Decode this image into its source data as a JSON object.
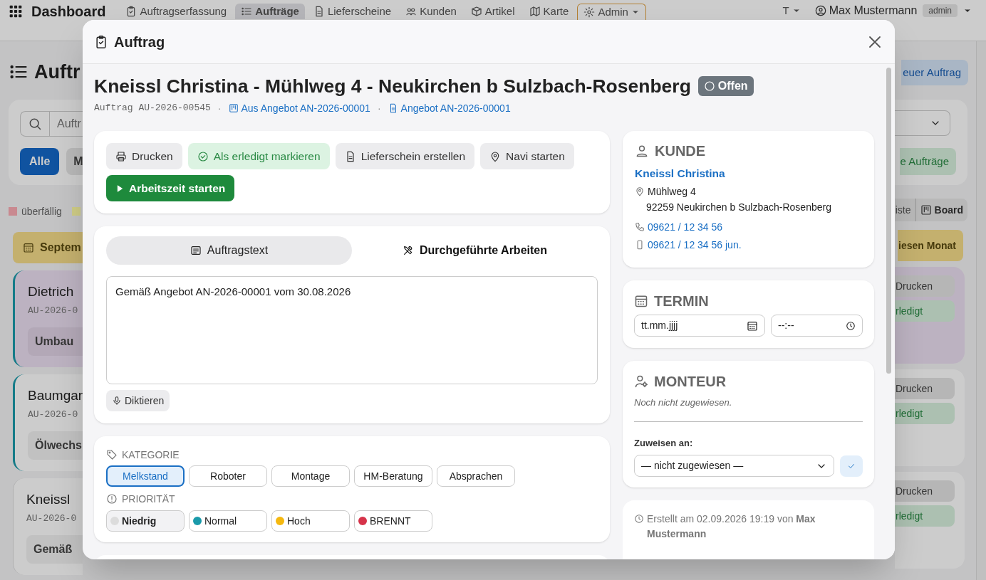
{
  "navbar": {
    "brand": "Dashboard",
    "items": [
      {
        "label": "Auftragserfassung",
        "selected": false,
        "kind": "link"
      },
      {
        "label": "Aufträge",
        "selected": true,
        "kind": "link"
      },
      {
        "label": "Lieferscheine",
        "selected": false,
        "kind": "link"
      },
      {
        "label": "Kunden",
        "selected": false,
        "kind": "link"
      },
      {
        "label": "Artikel",
        "selected": false,
        "kind": "link"
      },
      {
        "label": "Karte",
        "selected": false,
        "kind": "link"
      },
      {
        "label": "Admin",
        "selected": false,
        "kind": "dropdown"
      }
    ],
    "font_size": "T",
    "user": "Max Mustermann",
    "role": "admin"
  },
  "page": {
    "title": "Auftr",
    "new_button": "euer Auftrag",
    "search": {
      "placeholder": "Auftr"
    },
    "filters": [
      {
        "label": "Alle",
        "selected": true
      },
      {
        "label": "M",
        "selected": false
      }
    ],
    "open_button": "e Aufträge",
    "legend": [
      {
        "label": "überfällig",
        "color": "#c98990"
      },
      {
        "color": "#cfcc86"
      }
    ],
    "views": [
      {
        "label": "iste",
        "selected": false
      },
      {
        "label": "Board",
        "selected": true
      }
    ],
    "month": "Septem",
    "month_button": "iesen Monat",
    "cards": [
      {
        "title": "Dietrich",
        "number": "AU-2026-0",
        "text": "Umbau",
        "accent": true,
        "highlighted": true,
        "actions": [
          "Drucken",
          "rledigt"
        ]
      },
      {
        "title": "Baumgar",
        "number": "AU-2026-0",
        "text": "Ölwechs",
        "accent": true,
        "highlighted": false,
        "actions": [
          "Drucken",
          "rledigt"
        ]
      },
      {
        "title": "Kneissl",
        "number": "AU-2026-0",
        "text": "Gemäß",
        "accent": false,
        "highlighted": false,
        "actions": [
          "Drucken",
          "rledigt"
        ]
      }
    ]
  },
  "modal": {
    "title": "Auftrag",
    "heading": "Kneissl Christina - Mühlweg 4 - Neukirchen b Sulzbach-Rosenberg",
    "status": "Offen",
    "number": "Auftrag AU-2026-00545",
    "links": [
      {
        "separator": "·",
        "label": "Aus Angebot AN-2026-00001",
        "kind": "offer"
      },
      {
        "separator": "·",
        "label": "Angebot AN-2026-00001",
        "kind": "document"
      }
    ],
    "actions": [
      {
        "label": "Drucken",
        "kind": "print"
      },
      {
        "label": "Als erledigt markieren",
        "kind": "complete"
      },
      {
        "label": "Lieferschein erstellen",
        "kind": "delivery"
      },
      {
        "label": "Navi starten",
        "kind": "navigate"
      },
      {
        "label": "Arbeitszeit starten",
        "kind": "timer"
      }
    ],
    "tabs": [
      {
        "label": "Auftragstext",
        "selected": true
      },
      {
        "label": "Durchgeführte Arbeiten",
        "selected": false
      }
    ],
    "order_text": "Gemäß Angebot AN-2026-00001 vom 30.08.2026",
    "dictate_button": "Diktieren",
    "category": {
      "label": "KATEGORIE",
      "options": [
        {
          "label": "Melkstand",
          "selected": true
        },
        {
          "label": "Roboter",
          "selected": false
        },
        {
          "label": "Montage",
          "selected": false
        },
        {
          "label": "HM-Beratung",
          "selected": false
        },
        {
          "label": "Absprachen",
          "selected": false
        }
      ]
    },
    "priority": {
      "label": "PRIORITÄT",
      "options": [
        {
          "label": "Niedrig",
          "color": "#dcdcdc",
          "selected": true
        },
        {
          "label": "Normal",
          "color": "#1a9aaa",
          "selected": false
        },
        {
          "label": "Hoch",
          "color": "#f5b80f",
          "selected": false
        },
        {
          "label": "BRENNT",
          "color": "#d6334a",
          "selected": false
        }
      ]
    },
    "customer": {
      "label": "KUNDE",
      "name": "Kneissl Christina",
      "street": "Mühlweg 4",
      "city": "92259 Neukirchen b Sulzbach-Rosenberg",
      "phone": "09621 / 12 34 56",
      "mobile": "09621 / 12 34 56 jun."
    },
    "appointment": {
      "label": "TERMIN",
      "date_placeholder": "tt.mm.jjjj",
      "time_placeholder": "--:--"
    },
    "fitter": {
      "label": "MONTEUR",
      "note": "Noch nicht zugewiesen.",
      "assign_label": "Zuweisen an:",
      "select_value": "— nicht zugewiesen —"
    },
    "created": "Erstellt am 02.09.2026 19:19 von **Max Mustermann**"
  }
}
